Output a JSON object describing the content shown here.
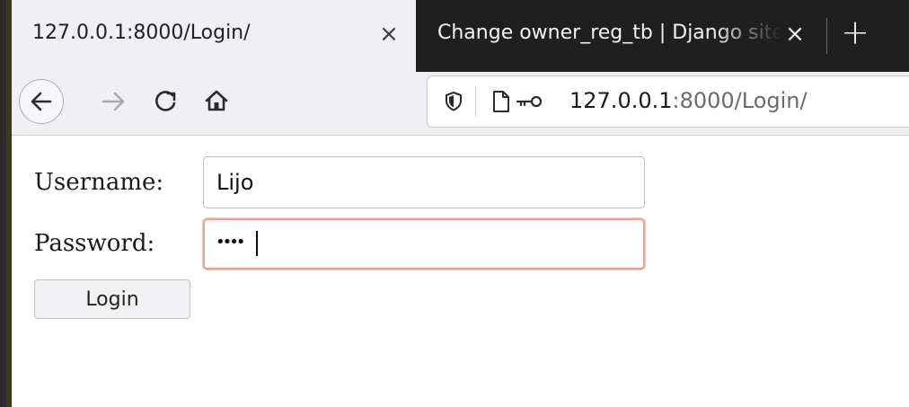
{
  "browser": {
    "tabs": [
      {
        "label": "127.0.0.1:8000/Login/",
        "active": true,
        "close_glyph": "×"
      },
      {
        "label": "Change owner_reg_tb | Django site admin",
        "active": false,
        "close_glyph": "×"
      }
    ],
    "new_tab_glyph": "+",
    "nav": {
      "back_icon": "back-arrow-icon",
      "forward_icon": "forward-arrow-icon",
      "reload_icon": "reload-icon",
      "home_icon": "home-icon"
    },
    "urlbar": {
      "shield_icon": "shield-icon",
      "page_icon": "page-icon",
      "key_icon": "key-icon",
      "host": "127.0.0.1",
      "rest": ":8000/Login/"
    },
    "colors": {
      "tab_strip": "#1f1f1f",
      "toolbar": "#f0f0f4",
      "focus_ring": "#e8a48e"
    }
  },
  "form": {
    "username_label": "Username:",
    "username_value": "Lijo",
    "password_label": "Password:",
    "password_mask": "••••",
    "submit_label": "Login"
  }
}
